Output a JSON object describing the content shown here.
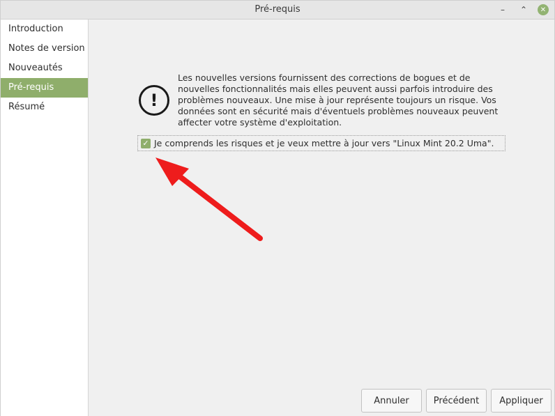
{
  "window": {
    "title": "Pré-requis",
    "controls": {
      "minimize": "–",
      "maximize": "⌃",
      "close": "✕"
    }
  },
  "sidebar": {
    "items": [
      {
        "label": "Introduction"
      },
      {
        "label": "Notes de version"
      },
      {
        "label": "Nouveautés"
      },
      {
        "label": "Pré-requis"
      },
      {
        "label": "Résumé"
      }
    ],
    "active_index": 3
  },
  "main": {
    "warning_icon_glyph": "!",
    "message": "Les nouvelles versions fournissent des corrections de bogues et de nouvelles fonctionnalités mais elles peuvent aussi parfois introduire des problèmes nouveaux. Une mise à jour représente toujours un risque. Vos données sont en sécurité mais d'éventuels problèmes nouveaux peuvent affecter votre système d'exploitation.",
    "checkbox": {
      "checked": true,
      "mark": "✓",
      "label": "Je comprends les risques et je veux mettre à jour vers \"Linux Mint 20.2 Uma\"."
    }
  },
  "buttons": {
    "cancel": "Annuler",
    "previous": "Précédent",
    "apply": "Appliquer"
  },
  "colors": {
    "accent": "#8fae6b",
    "arrow": "#ee1c1c"
  }
}
